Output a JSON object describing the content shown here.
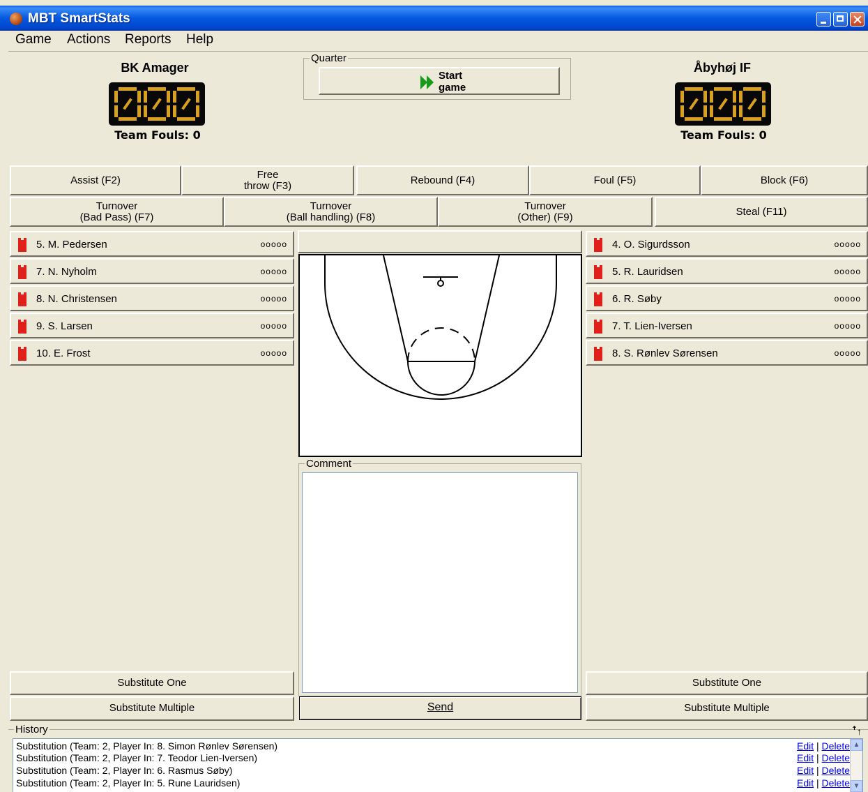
{
  "window": {
    "title": "MBT SmartStats"
  },
  "menu": [
    "Game",
    "Actions",
    "Reports",
    "Help"
  ],
  "home": {
    "name": "BK Amager",
    "score": "000",
    "fouls_label": "Team Fouls: 0"
  },
  "away": {
    "name": "Åbyhøj IF",
    "score": "000",
    "fouls_label": "Team Fouls: 0"
  },
  "quarter": {
    "label": "Quarter",
    "start_line1": "Start",
    "start_line2": "game"
  },
  "actions_row1": [
    {
      "label": "Assist (F2)"
    },
    {
      "label": "Free\nthrow (F3)"
    },
    {
      "label": "Rebound (F4)"
    },
    {
      "label": "Foul (F5)"
    },
    {
      "label": "Block (F6)"
    }
  ],
  "actions_row2": [
    {
      "label": "Turnover\n(Bad Pass) (F7)"
    },
    {
      "label": "Turnover\n(Ball handling) (F8)"
    },
    {
      "label": "Turnover\n(Other) (F9)"
    },
    {
      "label": "Steal (F11)"
    }
  ],
  "home_players": [
    {
      "name": "5. M. Pedersen",
      "dots": "ooooo"
    },
    {
      "name": "7. N. Nyholm",
      "dots": "ooooo"
    },
    {
      "name": "8. N. Christensen",
      "dots": "ooooo"
    },
    {
      "name": "9. S. Larsen",
      "dots": "ooooo"
    },
    {
      "name": "10. E. Frost",
      "dots": "ooooo"
    }
  ],
  "away_players": [
    {
      "name": "4. O. Sigurdsson",
      "dots": "ooooo"
    },
    {
      "name": "5. R. Lauridsen",
      "dots": "ooooo"
    },
    {
      "name": "6. R. Søby",
      "dots": "ooooo"
    },
    {
      "name": "7. T. Lien-Iversen",
      "dots": "ooooo"
    },
    {
      "name": "8. S. Rønlev Sørensen",
      "dots": "ooooo"
    }
  ],
  "substitute": {
    "one": "Substitute One",
    "multiple": "Substitute Multiple"
  },
  "comment": {
    "label": "Comment",
    "value": ""
  },
  "send_label": "Send",
  "history": {
    "label": "History",
    "collapse_icon": "ꜛ↑",
    "edit_label": "Edit",
    "separator": "|",
    "delete_label": "Delete",
    "entries": [
      "Substitution (Team: 2, Player In: 8. Simon Rønlev Sørensen)",
      "Substitution (Team: 2, Player In: 7. Teodor Lien-Iversen)",
      "Substitution (Team: 2, Player In: 6. Rasmus Søby)",
      "Substitution (Team: 2, Player In: 5. Rune Lauridsen)"
    ]
  },
  "colors": {
    "accent": "#0058e6",
    "digit": "#d9a020",
    "jersey": "#e0201a",
    "link": "#0000ee"
  }
}
